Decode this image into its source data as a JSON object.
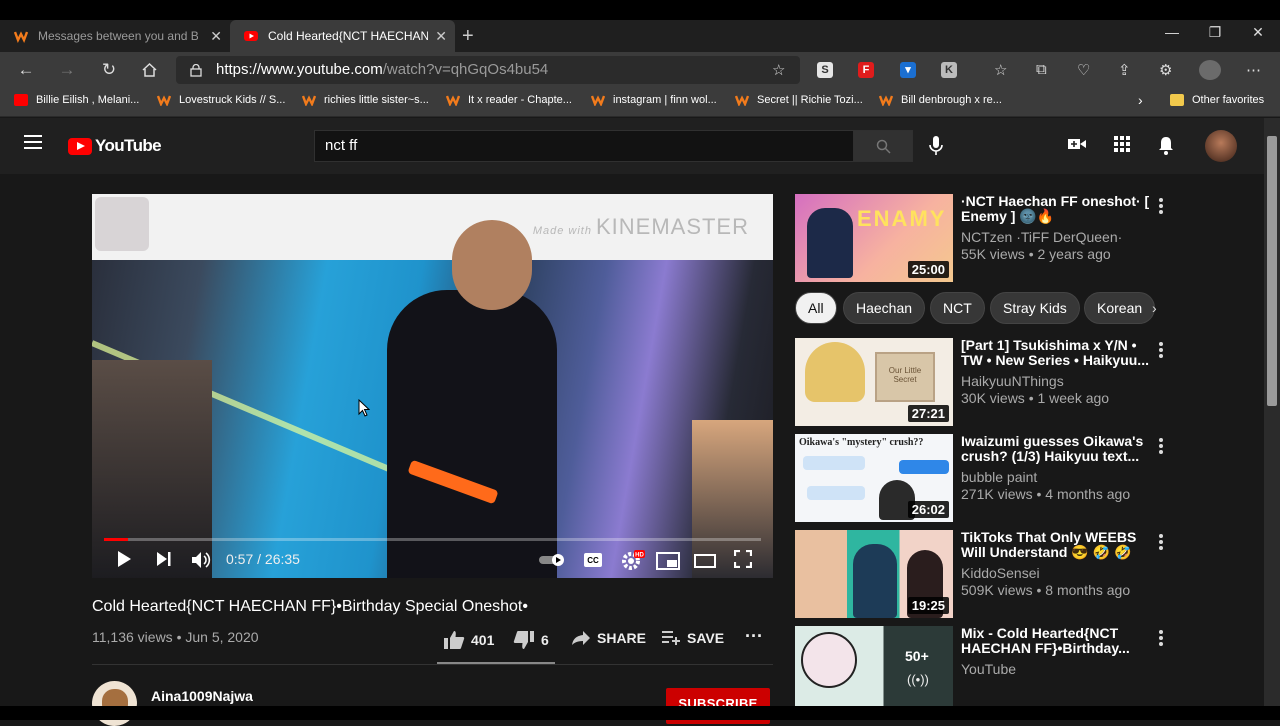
{
  "browser": {
    "tabs": [
      {
        "title": "Messages between you and Bella",
        "active": false
      },
      {
        "title": "Cold Hearted{NCT HAECHAN FF}•Birthday Special Oneshot•",
        "active": true
      }
    ],
    "url_host": "https://www.youtube.com",
    "url_path": "/watch?v=qhGqOs4bu54",
    "bookmarks": [
      "Billie Eilish , Melani...",
      "Lovestruck Kids // S...",
      "richies little sister~s...",
      "It x reader - Chapte...",
      "instagram | finn wol...",
      "Secret || Richie Tozi...",
      "Bill denbrough x re..."
    ],
    "other_favorites": "Other favorites",
    "colors": {
      "brand_red": "#ff0000",
      "wattpad_orange": "#f27b1c"
    }
  },
  "youtube": {
    "logo_text": "YouTube",
    "search_query": "nct ff",
    "video": {
      "watermark_small": "Made with",
      "watermark": "KINEMASTER",
      "time": "0:57 / 26:35",
      "progress_fraction": 0.036,
      "title": "Cold Hearted{NCT HAECHAN FF}•Birthday Special Oneshot•",
      "meta": "11,136 views • Jun 5, 2020",
      "likes": "401",
      "dislikes": "6",
      "share": "SHARE",
      "save": "SAVE",
      "channel": "Aina1009Najwa",
      "subscribe": "SUBSCRIBE"
    },
    "chips": [
      "All",
      "Haechan",
      "NCT",
      "Stray Kids",
      "Korean"
    ],
    "recommendations": [
      {
        "title": "·NCT Haechan FF oneshot· [ Enemy ] 🌚🔥",
        "channel": "NCTzen ·TiFF DerQueen·",
        "views": "55K views • 2 years ago",
        "duration": "25:00",
        "thumb_text": "ENAMY"
      },
      {
        "title": "[Part 1] Tsukishima x Y/N • TW • New Series • Haikyuu...",
        "channel": "HaikyuuNThings",
        "views": "30K views • 1 week ago",
        "duration": "27:21",
        "thumb_text": "Our Little Secret"
      },
      {
        "title": "Iwaizumi guesses Oikawa's crush? (1/3) Haikyuu text...",
        "channel": "bubble paint",
        "views": "271K views • 4 months ago",
        "duration": "26:02",
        "thumb_text": "Oikawa's \"mystery\" crush??"
      },
      {
        "title": "TikToks That Only WEEBS Will Understand 😎 🤣 🤣",
        "channel": "KiddoSensei",
        "views": "509K views • 8 months ago",
        "duration": "19:25",
        "thumb_text": ""
      },
      {
        "title": "Mix - Cold Hearted{NCT HAECHAN FF}•Birthday...",
        "channel": "YouTube",
        "views": "",
        "duration": "",
        "thumb_text": "50+"
      }
    ]
  }
}
